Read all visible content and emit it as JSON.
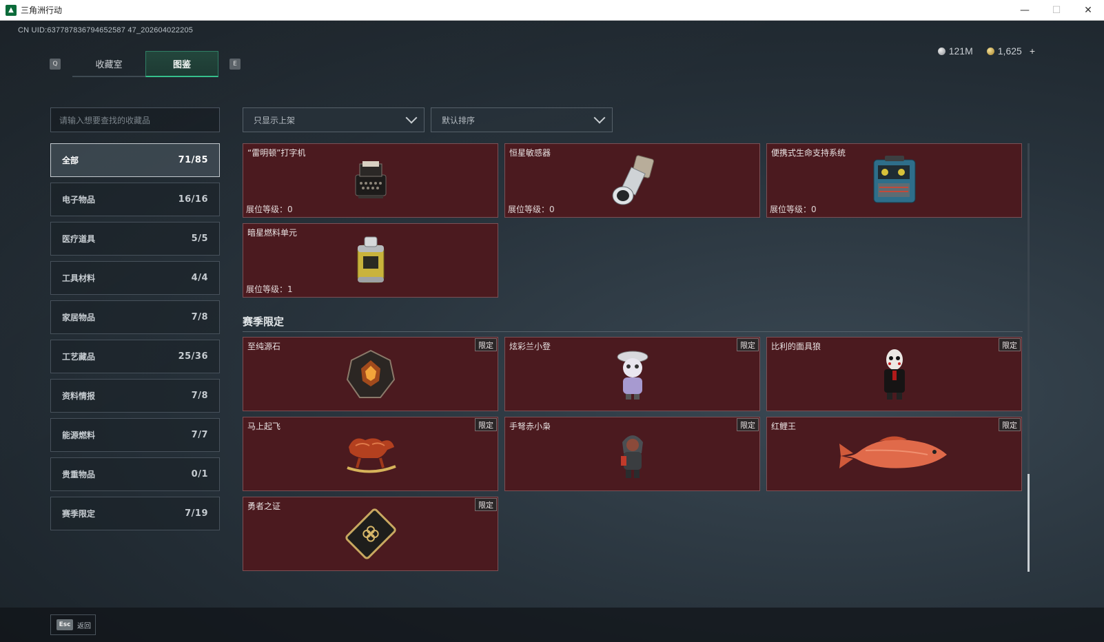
{
  "window": {
    "title": "三角洲行动",
    "icon": "app-logo-icon",
    "controls": {
      "minimize": "—",
      "maximize": "☐",
      "close": "✕"
    }
  },
  "uid": "CN UID:637787836794652587 47_202604022205",
  "currency": [
    {
      "icon": "silver-coin-icon",
      "value": "121M"
    },
    {
      "icon": "gold-coin-icon",
      "value": "1,625"
    }
  ],
  "currency_plus": "+",
  "tabs": {
    "left_key": "Q",
    "right_key": "E",
    "items": [
      {
        "label": "收藏室",
        "active": false
      },
      {
        "label": "图鉴",
        "active": true
      }
    ]
  },
  "search": {
    "placeholder": "请输入想要查找的收藏品"
  },
  "filters": {
    "shelf": "只显示上架",
    "sort": "默认排序"
  },
  "categories": [
    {
      "label": "全部",
      "count": "71/85",
      "active": true
    },
    {
      "label": "电子物品",
      "count": "16/16"
    },
    {
      "label": "医疗道具",
      "count": "5/5"
    },
    {
      "label": "工具材料",
      "count": "4/4"
    },
    {
      "label": "家居物品",
      "count": "7/8"
    },
    {
      "label": "工艺藏品",
      "count": "25/36"
    },
    {
      "label": "资料情报",
      "count": "7/8"
    },
    {
      "label": "能源燃料",
      "count": "7/7"
    },
    {
      "label": "贵重物品",
      "count": "0/1"
    },
    {
      "label": "赛季限定",
      "count": "7/19"
    }
  ],
  "items_top": [
    {
      "name": "“雷明顿”打字机",
      "level": "展位等级：0",
      "icon": "typewriter-icon"
    },
    {
      "name": "恒星敏感器",
      "level": "展位等级：0",
      "icon": "star-sensor-icon"
    },
    {
      "name": "便携式生命支持系统",
      "level": "展位等级：0",
      "icon": "life-support-icon"
    },
    {
      "name": "暗星燃料单元",
      "level": "展位等级：1",
      "icon": "fuel-cell-icon"
    }
  ],
  "season_section": {
    "title": "赛季限定"
  },
  "limited_badge": "限定",
  "items_season": [
    {
      "name": "至纯源石",
      "icon": "gem-icon"
    },
    {
      "name": "炫彩兰小登",
      "icon": "figurine-icon"
    },
    {
      "name": "比利的面具狼",
      "icon": "puppet-icon"
    },
    {
      "name": "马上起飞",
      "icon": "rocking-horse-icon"
    },
    {
      "name": "手弩赤小枭",
      "icon": "hooded-figure-icon"
    },
    {
      "name": "红鲤王",
      "icon": "carp-icon"
    },
    {
      "name": "勇者之证",
      "icon": "badge-card-icon"
    }
  ],
  "footer": {
    "esc_key": "Esc",
    "back_label": "返回"
  },
  "colors": {
    "card_bg": "#4b1a1f",
    "tab_accent": "#36c08c"
  }
}
